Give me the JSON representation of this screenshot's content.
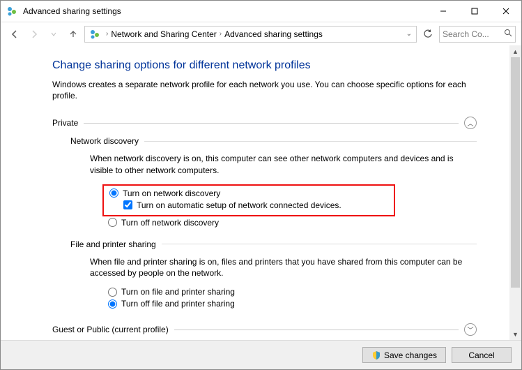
{
  "window": {
    "title": "Advanced sharing settings"
  },
  "breadcrumb": {
    "parent": "Network and Sharing Center",
    "current": "Advanced sharing settings"
  },
  "search": {
    "placeholder": "Search Co..."
  },
  "page": {
    "heading": "Change sharing options for different network profiles",
    "intro": "Windows creates a separate network profile for each network you use. You can choose specific options for each profile."
  },
  "sections": {
    "private": {
      "label": "Private",
      "network_discovery": {
        "title": "Network discovery",
        "desc": "When network discovery is on, this computer can see other network computers and devices and is visible to other network computers.",
        "on_label": "Turn on network discovery",
        "auto_label": "Turn on automatic setup of network connected devices.",
        "off_label": "Turn off network discovery"
      },
      "file_printer": {
        "title": "File and printer sharing",
        "desc": "When file and printer sharing is on, files and printers that you have shared from this computer can be accessed by people on the network.",
        "on_label": "Turn on file and printer sharing",
        "off_label": "Turn off file and printer sharing"
      }
    },
    "guest": {
      "label": "Guest or Public (current profile)"
    }
  },
  "footer": {
    "save": "Save changes",
    "cancel": "Cancel"
  }
}
